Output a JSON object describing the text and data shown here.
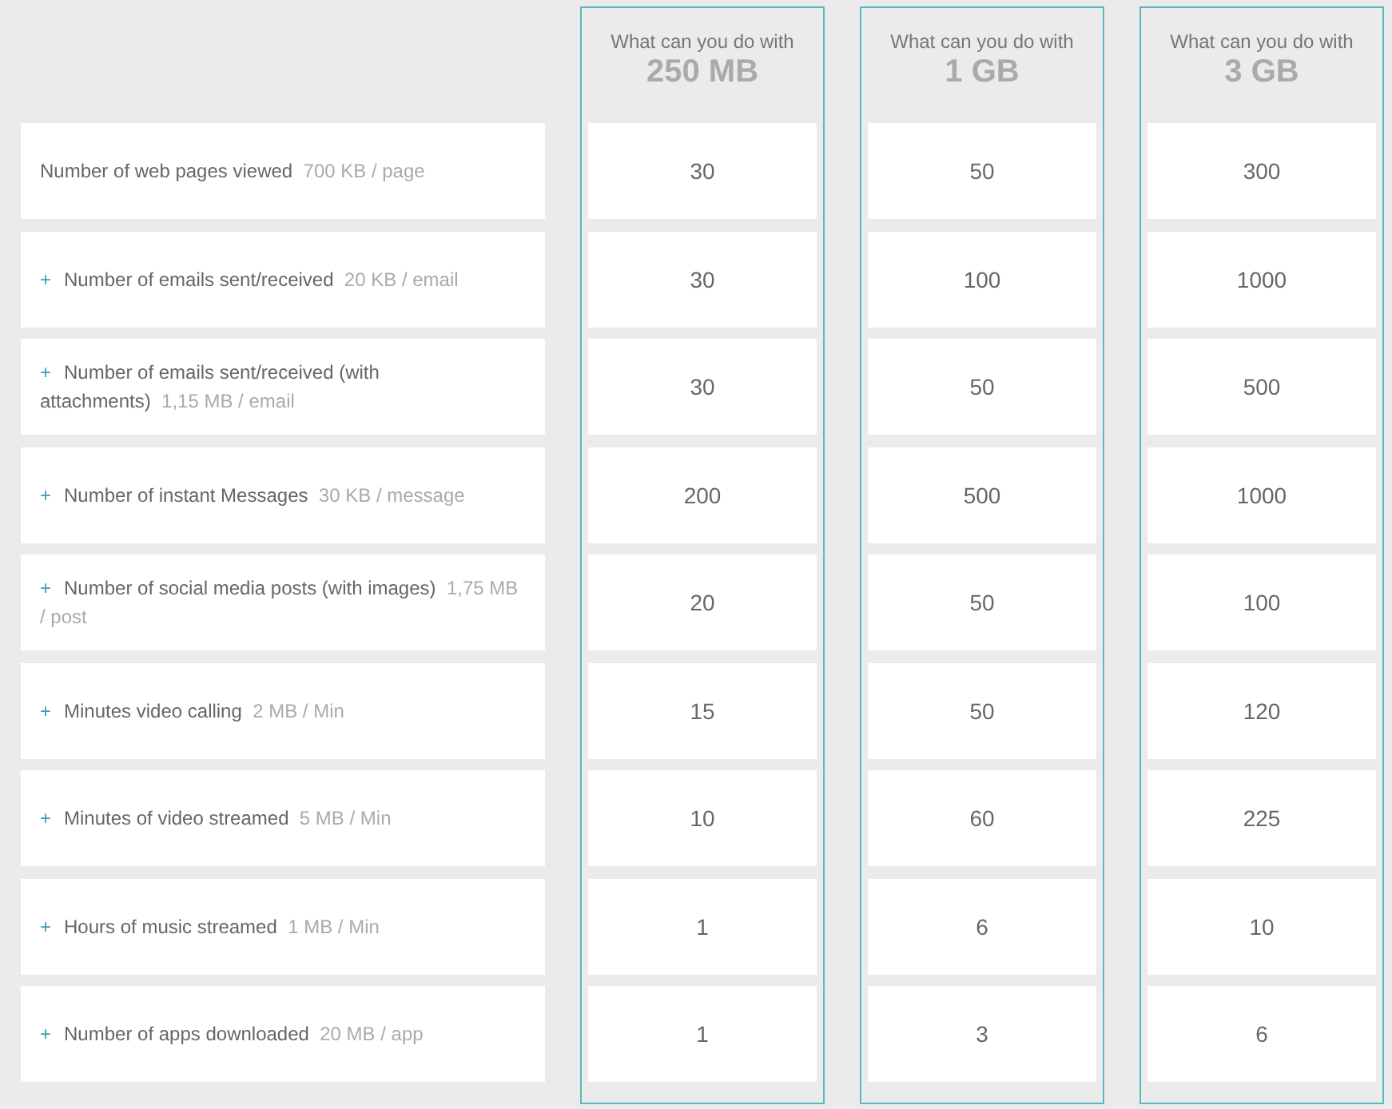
{
  "plans": [
    {
      "prefix": "What can you do with",
      "size": "250 MB",
      "values": [
        "30",
        "30",
        "30",
        "200",
        "20",
        "15",
        "10",
        "1",
        "1"
      ]
    },
    {
      "prefix": "What can you do with",
      "size": "1 GB",
      "values": [
        "50",
        "100",
        "50",
        "500",
        "50",
        "50",
        "60",
        "6",
        "3"
      ]
    },
    {
      "prefix": "What can you do with",
      "size": "3 GB",
      "values": [
        "300",
        "1000",
        "500",
        "1000",
        "100",
        "120",
        "225",
        "10",
        "6"
      ]
    }
  ],
  "rows": [
    {
      "label": "Number of web pages viewed",
      "unit": "700 KB / page"
    },
    {
      "icon": "+",
      "label": "Number of emails sent/received",
      "unit": "20 KB / email"
    },
    {
      "icon": "+",
      "label": "Number of emails sent/received (with attachments)",
      "unit": "1,15 MB / email"
    },
    {
      "icon": "+",
      "label": "Number of instant Messages",
      "unit": "30 KB / message"
    },
    {
      "icon": "+",
      "label": "Number of social media posts (with images)",
      "unit": "1,75 MB / post"
    },
    {
      "icon": "+",
      "label": "Minutes video calling",
      "unit": "2 MB / Min"
    },
    {
      "icon": "+",
      "label": "Minutes of video streamed",
      "unit": "5 MB / Min"
    },
    {
      "icon": "+",
      "label": "Hours of music streamed",
      "unit": "1 MB / Min"
    },
    {
      "icon": "+",
      "label": "Number of apps downloaded",
      "unit": "20 MB / app"
    }
  ]
}
